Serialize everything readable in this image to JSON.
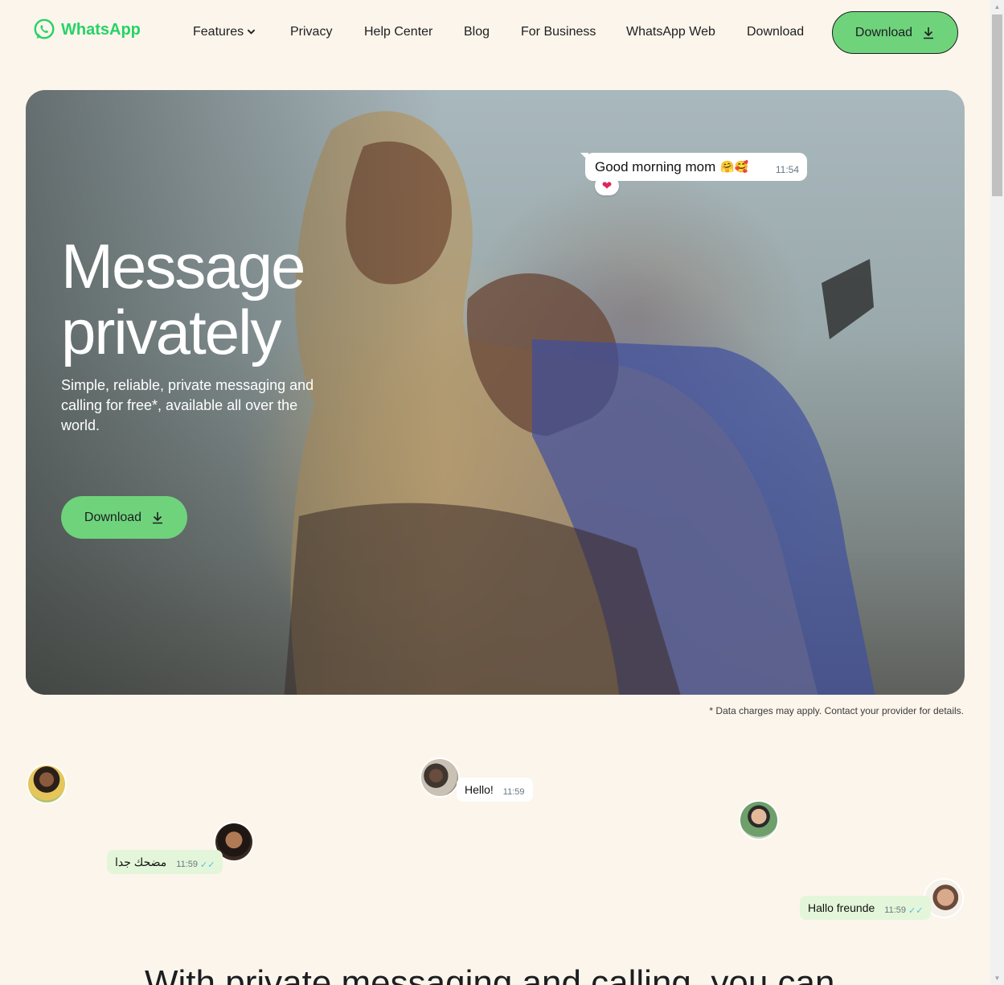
{
  "brand": {
    "name": "WhatsApp",
    "color": "#25d366"
  },
  "nav": {
    "items": [
      "Features",
      "Privacy",
      "Help Center",
      "Blog",
      "For Business",
      "WhatsApp Web",
      "Download"
    ],
    "cta_label": "Download"
  },
  "hero": {
    "title_line1": "Message",
    "title_line2": "privately",
    "subtitle": "Simple, reliable, private messaging and calling for free*, available all over the world.",
    "cta_label": "Download",
    "bubble": {
      "text": "Good morning mom",
      "emoji": "🤗🥰",
      "time": "11:54",
      "reaction": "❤"
    }
  },
  "footnote": "* Data charges may apply. Contact your provider for details.",
  "chats": [
    {
      "text": "Hello!",
      "time": "11:59"
    },
    {
      "text": "مضحك جدا",
      "time": "11:59",
      "ticks": "✓✓"
    },
    {
      "text": "Hallo freunde",
      "time": "11:59",
      "ticks": "✓✓"
    }
  ],
  "section_heading": "With private messaging and calling, you can"
}
